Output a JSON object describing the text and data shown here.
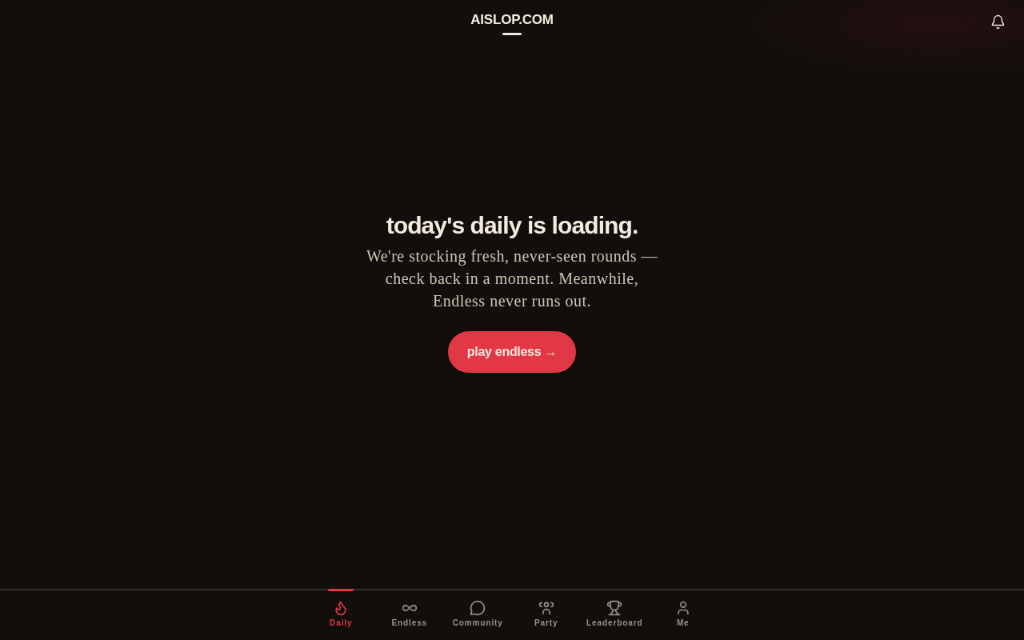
{
  "header": {
    "logo": "AISLOP.COM"
  },
  "notice": {
    "title": "today's daily is loading.",
    "message": "We're stocking fresh, never-seen rounds — check back in a moment. Meanwhile, Endless never runs out.",
    "button": "play endless →"
  },
  "bottom_nav": [
    {
      "label": "Daily",
      "selected": true
    },
    {
      "label": "Endless",
      "selected": false
    },
    {
      "label": "Community",
      "selected": false
    },
    {
      "label": "Party",
      "selected": false
    },
    {
      "label": "Leaderboard",
      "selected": false
    },
    {
      "label": "Me",
      "selected": false
    }
  ]
}
